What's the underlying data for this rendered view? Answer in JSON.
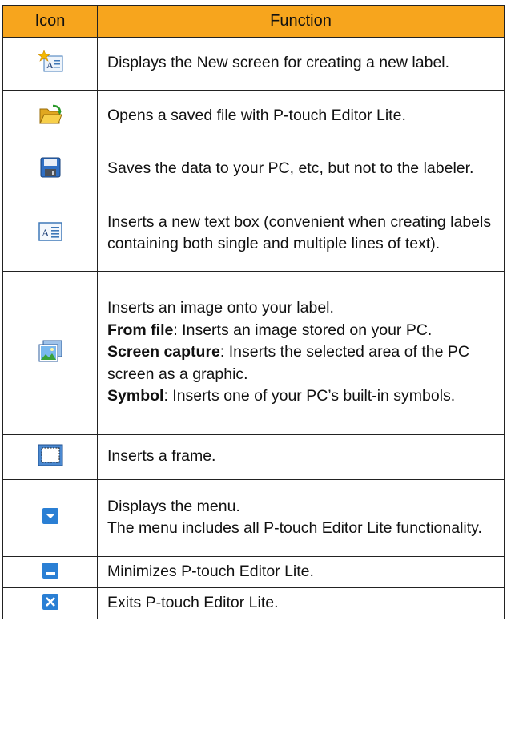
{
  "table": {
    "headers": {
      "icon": "Icon",
      "function": "Function"
    },
    "rows": [
      {
        "icon": "new-label-icon",
        "lines": [
          {
            "text": "Displays the New screen for creating a new label."
          }
        ]
      },
      {
        "icon": "open-folder-icon",
        "lines": [
          {
            "text": "Opens a saved file with P-touch Editor Lite."
          }
        ]
      },
      {
        "icon": "save-disk-icon",
        "lines": [
          {
            "text": "Saves the data to your PC, etc, but not to the labeler."
          }
        ]
      },
      {
        "icon": "text-box-icon",
        "lines": [
          {
            "text": "Inserts a new text box (convenient when creating labels containing both single and multiple lines of text)."
          }
        ]
      },
      {
        "icon": "image-icon",
        "lines": [
          {
            "text": "Inserts an image onto your label."
          },
          {
            "bold": "From file",
            "text": ": Inserts an image stored on your PC."
          },
          {
            "bold": "Screen capture",
            "text": ": Inserts the selected area of the PC screen as a graphic."
          },
          {
            "bold": "Symbol",
            "text": ": Inserts one of your PC’s built-in symbols."
          }
        ]
      },
      {
        "icon": "frame-icon",
        "lines": [
          {
            "text": "Inserts a frame."
          }
        ]
      },
      {
        "icon": "menu-dropdown-icon",
        "lines": [
          {
            "text": "Displays the menu."
          },
          {
            "text": "The menu includes all P-touch Editor Lite functionality."
          }
        ]
      },
      {
        "icon": "minimize-icon",
        "lines": [
          {
            "text": "Minimizes P-touch Editor Lite."
          }
        ]
      },
      {
        "icon": "close-icon",
        "lines": [
          {
            "text": "Exits P-touch Editor Lite."
          }
        ]
      }
    ]
  },
  "colors": {
    "header_bg": "#f7a51d",
    "icon_blue": "#2a7fd4"
  }
}
